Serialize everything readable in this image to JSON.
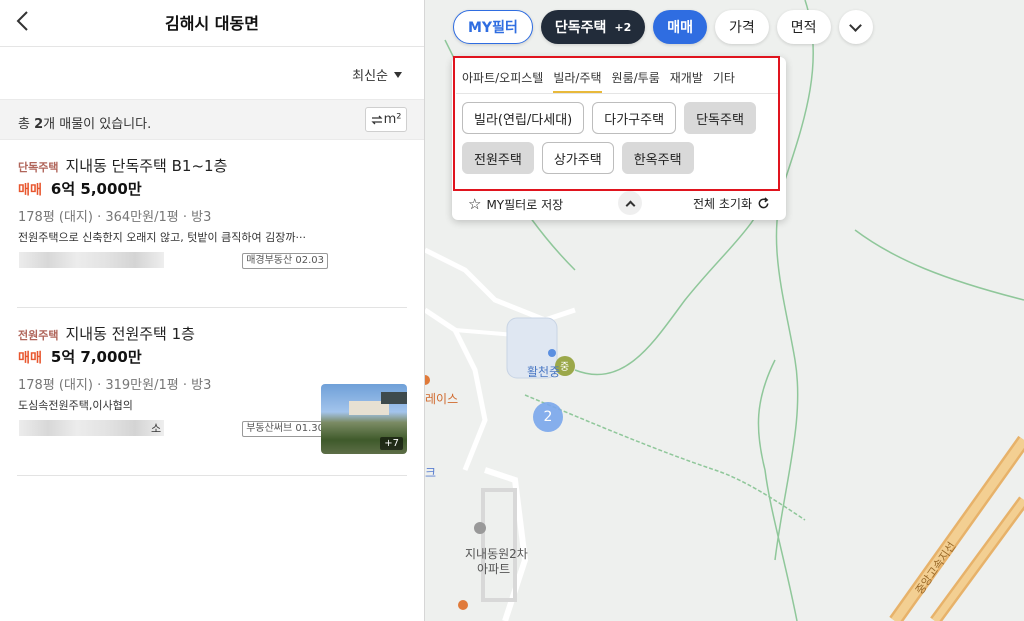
{
  "header": {
    "title": "김해시 대동면"
  },
  "sort": {
    "label": "최신순"
  },
  "summary": {
    "prefix": "총 ",
    "count": "2",
    "suffix": "개 매물이 있습니다.",
    "unit_toggle": "m²"
  },
  "listings": [
    {
      "tag": "단독주택",
      "name": "지내동 단독주택 B1~1층",
      "deal": "매매",
      "price": "6억 5,000만",
      "spec": "178평 (대지) · 364만원/1평 · 방3",
      "desc": "전원주택으로 신축한지 오래지 않고, 텃밭이 큼직하여 김장까···",
      "agent_badge": "매경부동산 02.03"
    },
    {
      "tag": "전원주택",
      "name": "지내동 전원주택 1층",
      "deal": "매매",
      "price": "5억 7,000만",
      "spec": "178평 (대지) · 319만원/1평 · 방3",
      "desc": "도심속전원주택,이사협의",
      "agent_mark": "소",
      "agent_badge": "부동산써브 01.30",
      "photo_count": "+7"
    }
  ],
  "chips": {
    "my": "MY필터",
    "house": "단독주택",
    "house_plus": "+2",
    "sale": "매매",
    "price": "가격",
    "area": "면적"
  },
  "panel": {
    "tabs": [
      "아파트/오피스텔",
      "빌라/주택",
      "원룸/투룸",
      "재개발",
      "기타"
    ],
    "active_tab": "빌라/주택",
    "options": [
      {
        "label": "빌라(연립/다세대)",
        "selected": false
      },
      {
        "label": "다가구주택",
        "selected": false
      },
      {
        "label": "단독주택",
        "selected": true
      },
      {
        "label": "전원주택",
        "selected": true
      },
      {
        "label": "상가주택",
        "selected": false
      },
      {
        "label": "한옥주택",
        "selected": true
      }
    ],
    "save_label": "MY필터로 저장",
    "reset_label": "전체 초기화"
  },
  "map": {
    "cluster_count": "2",
    "labels": [
      "활천중",
      "중",
      "레이스",
      "지내동원2차",
      "아파트",
      "크",
      "중앙고속지선"
    ]
  },
  "colors": {
    "accent": "#2f6de1",
    "deal": "#e8562e",
    "tag": "#b0655a",
    "highlight": "#e0141e"
  }
}
